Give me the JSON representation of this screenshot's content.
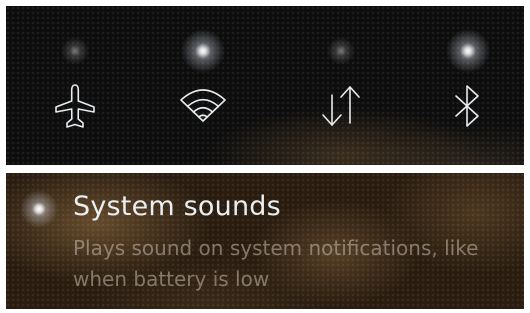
{
  "quick_toggles": [
    {
      "id": "flight_mode",
      "icon": "airplane-icon",
      "enabled": false
    },
    {
      "id": "wlan",
      "icon": "wifi-icon",
      "enabled": true
    },
    {
      "id": "mobile_data",
      "icon": "mobile-data-icon",
      "enabled": false
    },
    {
      "id": "bluetooth",
      "icon": "bluetooth-icon",
      "enabled": true
    }
  ],
  "system_sounds": {
    "title": "System sounds",
    "description": "Plays sound on system notifications, like when battery is low",
    "enabled": true
  },
  "colors": {
    "icon_stroke": "#e8ecef",
    "title_text": "#eaeef0",
    "description_text": "#c8beb0"
  }
}
